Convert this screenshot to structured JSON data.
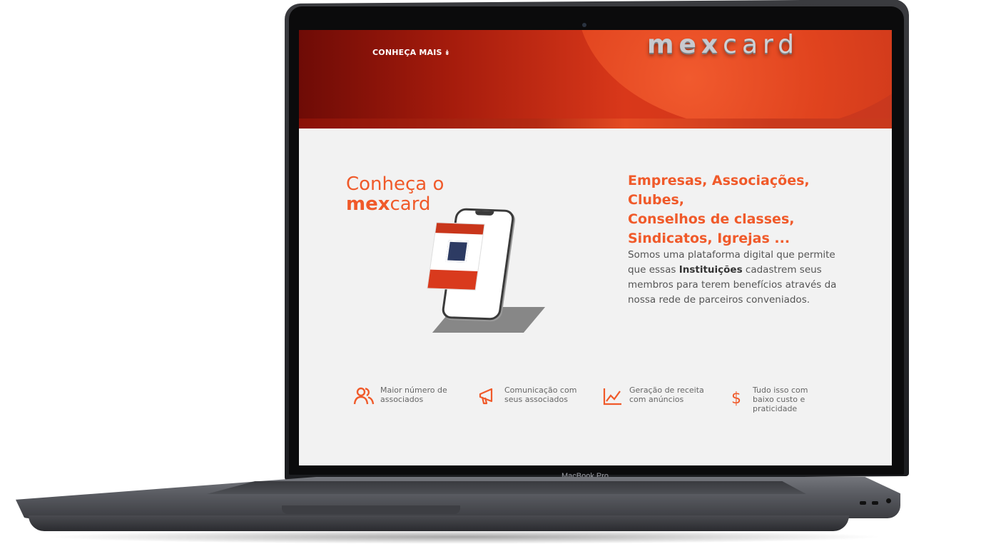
{
  "device": {
    "model_label": "MacBook Pro"
  },
  "site": {
    "colors": {
      "accent": "#f05a2a",
      "hero_dark": "#6e0b06",
      "hero_light": "#e44b22"
    },
    "hero": {
      "nav_link": "CONHEÇA MAIS",
      "nav_icon": "double-chevron-down-icon",
      "brand_bold": "mex",
      "brand_light": "card"
    },
    "intro": {
      "title_line1": "Conheça o",
      "title_mex": "mex",
      "title_card": "card"
    },
    "tagline": {
      "line1": "Empresas, Associações, Clubes,",
      "line2": "Conselhos de classes,",
      "line3": "Sindicatos, Igrejas ..."
    },
    "description": {
      "part1": "Somos uma plataforma digital que permite que essas ",
      "bold": "Instituições",
      "part2": " cadastrem seus membros para terem benefícios através da nossa rede de parceiros conveniados."
    },
    "features": [
      {
        "icon": "users-icon",
        "label": "Maior número de associados"
      },
      {
        "icon": "megaphone-icon",
        "label": "Comunicação com seus associados"
      },
      {
        "icon": "line-chart-icon",
        "label": "Geração de receita com anúncios"
      },
      {
        "icon": "dollar-icon",
        "label": "Tudo isso com baixo custo e praticidade"
      }
    ]
  }
}
